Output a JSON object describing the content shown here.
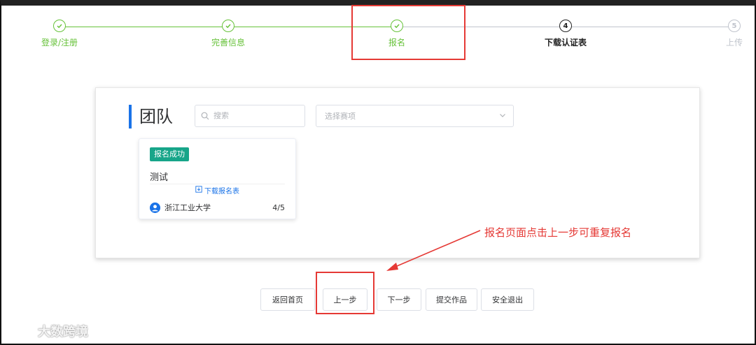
{
  "steps": [
    {
      "label": "登录/注册",
      "status": "done"
    },
    {
      "label": "完善信息",
      "status": "done"
    },
    {
      "label": "报名",
      "status": "done"
    },
    {
      "label": "下载认证表",
      "status": "current",
      "number": "4"
    },
    {
      "label": "上传",
      "status": "wait",
      "number": "5"
    }
  ],
  "colors": {
    "success": "#67c23a",
    "accent": "#1a73e8",
    "badge": "#17a589",
    "annotation": "#e53935"
  },
  "panel": {
    "title": "团队",
    "search_placeholder": "搜索",
    "select_placeholder": "选择赛项"
  },
  "team_card": {
    "badge": "报名成功",
    "name": "测试",
    "download_label": "下载报名表",
    "school": "浙江工业大学",
    "count": "4/5"
  },
  "annotation": {
    "text": "报名页面点击上一步可重复报名"
  },
  "buttons": {
    "home": "返回首页",
    "prev": "上一步",
    "next": "下一步",
    "submit": "提交作品",
    "logout": "安全退出"
  },
  "watermark": {
    "text": "大数跨境"
  }
}
